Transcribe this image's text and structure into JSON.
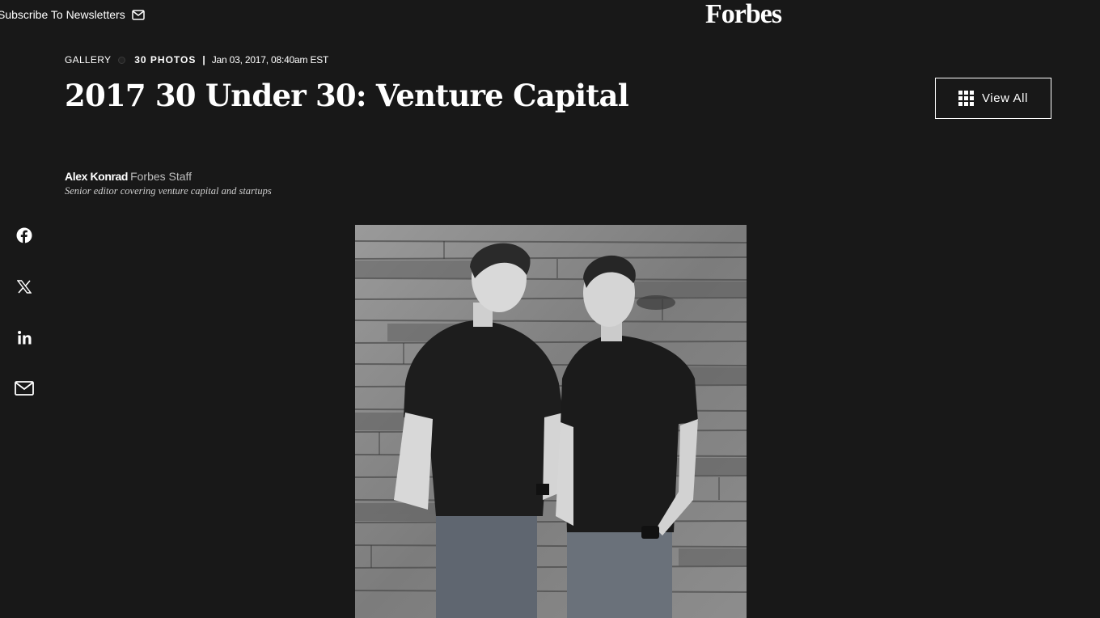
{
  "header": {
    "subscribe_label": "Subscribe To Newsletters",
    "logo_text": "Forbes"
  },
  "meta": {
    "gallery_label": "GALLERY",
    "photos_count": "30 PHOTOS",
    "separator": "|",
    "date": "Jan 03, 2017, 08:40am EST"
  },
  "article": {
    "title": "2017 30 Under 30: Venture Capital"
  },
  "view_all": {
    "label": "View All"
  },
  "author": {
    "name": "Alex Konrad",
    "role": "Forbes Staff",
    "description": "Senior editor covering venture capital and startups"
  },
  "social": {
    "icons": [
      "facebook-icon",
      "x-icon",
      "linkedin-icon",
      "mail-icon"
    ]
  },
  "colors": {
    "background": "#181818",
    "text": "#ffffff",
    "muted": "#bdbdbd"
  }
}
